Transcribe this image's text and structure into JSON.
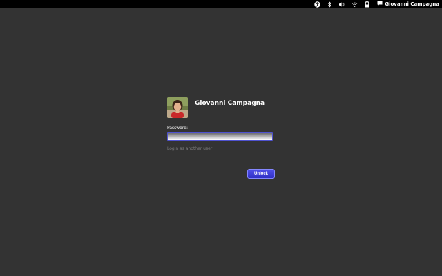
{
  "topbar": {
    "user_name": "Giovanni Campagna",
    "icons": [
      "accessibility-icon",
      "bluetooth-icon",
      "volume-icon",
      "wifi-icon",
      "battery-icon",
      "chat-icon"
    ]
  },
  "dialog": {
    "user_name": "Giovanni Campagna",
    "password_label": "Password:",
    "password_value": "",
    "other_user_link": "Login as another user",
    "unlock_label": "Unlock"
  },
  "colors": {
    "background": "#333333",
    "topbar": "#000000",
    "accent": "#4040d8",
    "link": "#7c7c7c"
  }
}
